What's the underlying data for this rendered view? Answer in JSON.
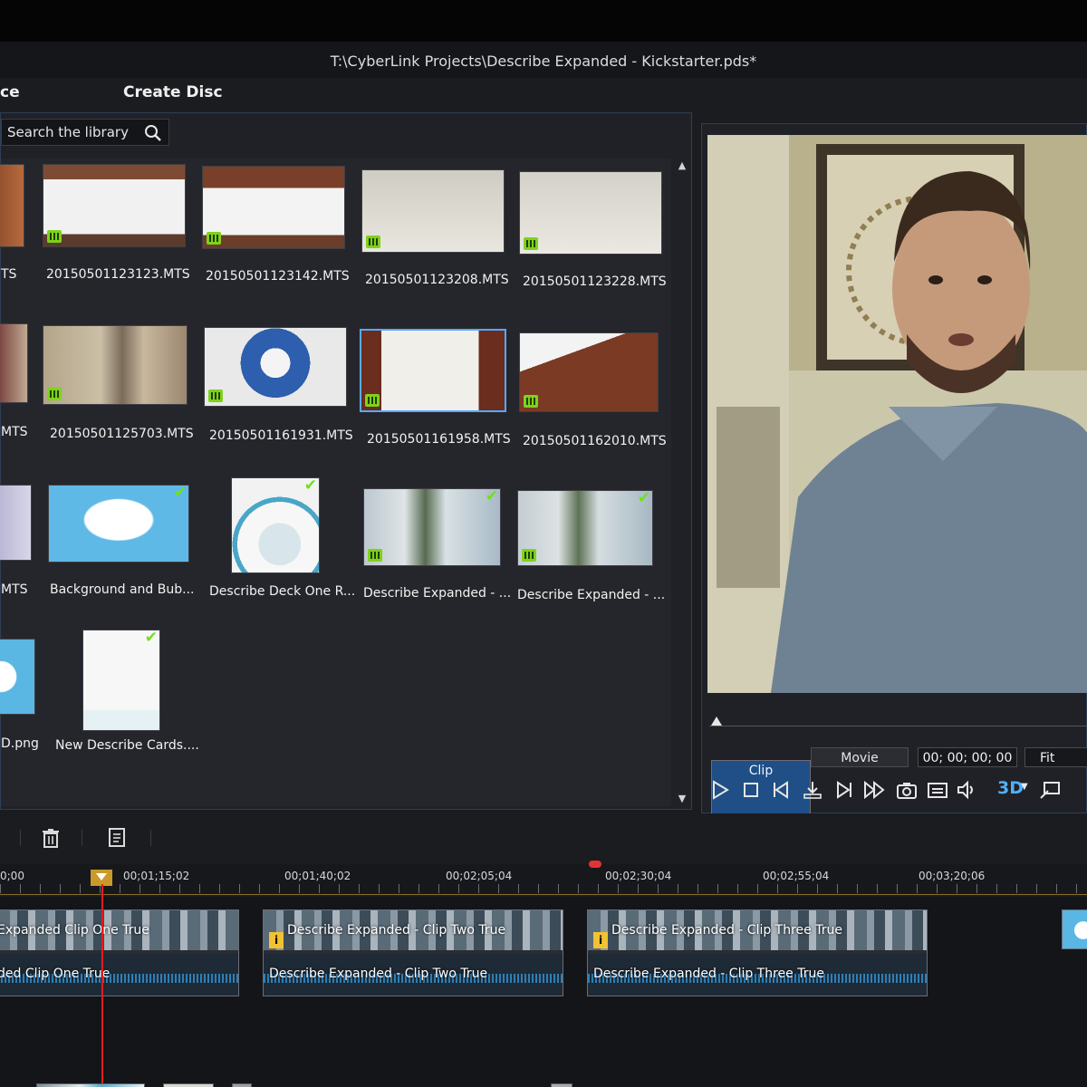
{
  "window": {
    "title": "T:\\CyberLink Projects\\Describe Expanded - Kickstarter.pds*"
  },
  "rooms": {
    "partial_label": "ce",
    "create_disc": "Create Disc"
  },
  "library": {
    "search_placeholder": "Search the library",
    "items": [
      {
        "name": "TS",
        "kind": "video",
        "checked": false
      },
      {
        "name": "20150501123123.MTS",
        "kind": "video",
        "checked": false
      },
      {
        "name": "20150501123142.MTS",
        "kind": "video",
        "checked": false
      },
      {
        "name": "20150501123208.MTS",
        "kind": "video",
        "checked": false
      },
      {
        "name": "20150501123228.MTS",
        "kind": "video",
        "checked": false
      },
      {
        "name": "MTS",
        "kind": "video",
        "checked": false
      },
      {
        "name": "20150501125703.MTS",
        "kind": "video",
        "checked": false
      },
      {
        "name": "20150501161931.MTS",
        "kind": "video",
        "checked": false
      },
      {
        "name": "20150501161958.MTS",
        "kind": "video",
        "checked": false,
        "selected": true
      },
      {
        "name": "20150501162010.MTS",
        "kind": "video",
        "checked": false
      },
      {
        "name": "MTS",
        "kind": "video",
        "checked": false
      },
      {
        "name": "Background and Bub...",
        "kind": "image",
        "checked": true
      },
      {
        "name": "Describe Deck One R...",
        "kind": "image",
        "checked": true
      },
      {
        "name": "Describe Expanded - ...",
        "kind": "video",
        "checked": true
      },
      {
        "name": "Describe Expanded - ...",
        "kind": "video",
        "checked": true
      },
      {
        "name": "D.png",
        "kind": "image",
        "checked": false
      },
      {
        "name": "New Describe Cards....",
        "kind": "image",
        "checked": true
      }
    ]
  },
  "preview": {
    "mode_clip": "Clip",
    "mode_movie": "Movie",
    "timecode": "00; 00; 00; 00",
    "fit": "Fit",
    "three_d": "3D"
  },
  "timeline": {
    "ruler": [
      "0;00",
      "00;01;15;02",
      "00;01;40;02",
      "00;02;05;04",
      "00;02;30;04",
      "00;02;55;04",
      "00;03;20;06"
    ],
    "clips": [
      {
        "title": "Expanded Clip One True",
        "audio": "ded Clip One True"
      },
      {
        "title": "Describe Expanded - Clip Two True",
        "audio": "Describe Expanded - Clip Two True"
      },
      {
        "title": "Describe Expanded - Clip Three True",
        "audio": "Describe Expanded - Clip Three True"
      }
    ],
    "info_badge": "i"
  },
  "colors": {
    "accent": "#1f4f86",
    "selection": "#58a9ff",
    "playhead": "#e21d1d",
    "check": "#6fe11b"
  }
}
